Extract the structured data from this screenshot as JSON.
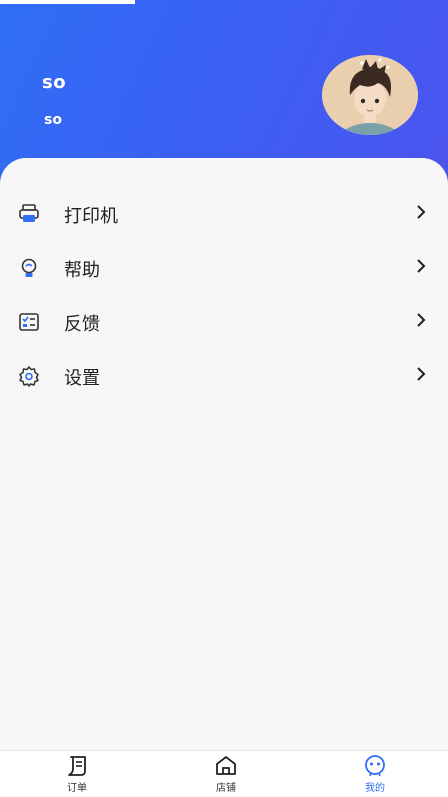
{
  "profile": {
    "username": "so",
    "subname": "so"
  },
  "menu": {
    "items": [
      {
        "label": "打印机",
        "icon": "printer-icon"
      },
      {
        "label": "帮助",
        "icon": "help-bulb-icon"
      },
      {
        "label": "反馈",
        "icon": "feedback-icon"
      },
      {
        "label": "设置",
        "icon": "settings-icon"
      }
    ]
  },
  "tabbar": {
    "tabs": [
      {
        "label": "订单",
        "icon": "order-icon"
      },
      {
        "label": "店铺",
        "icon": "store-icon"
      },
      {
        "label": "我的",
        "icon": "profile-icon",
        "active": true
      }
    ]
  },
  "colors": {
    "accent": "#2f6ef5",
    "header_gradient_end": "#4b54ee",
    "background": "#f7f7f7"
  }
}
